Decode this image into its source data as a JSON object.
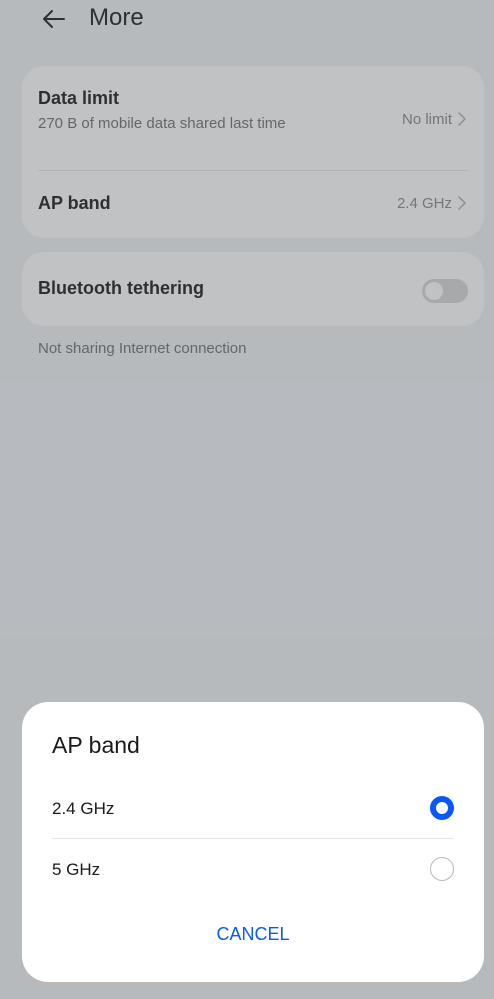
{
  "header": {
    "title": "More",
    "back_icon": "arrow-left-icon"
  },
  "settings": {
    "data_limit": {
      "title": "Data limit",
      "subtitle": "270 B of mobile data shared last time",
      "value": "No limit",
      "icon": "chevron-right-icon"
    },
    "ap_band": {
      "title": "AP band",
      "value": "2.4 GHz",
      "icon": "chevron-right-icon"
    },
    "bluetooth_tethering": {
      "title": "Bluetooth tethering",
      "enabled": false,
      "footnote": "Not sharing Internet connection"
    }
  },
  "dialog": {
    "title": "AP band",
    "options": [
      {
        "label": "2.4 GHz",
        "selected": true
      },
      {
        "label": "5 GHz",
        "selected": false
      }
    ],
    "cancel_label": "CANCEL"
  },
  "colors": {
    "accent": "#0a59f7",
    "page_background": "#f1f3f5",
    "card_background": "#ffffff",
    "scrim": "rgba(80, 86, 92, 0.36)"
  }
}
